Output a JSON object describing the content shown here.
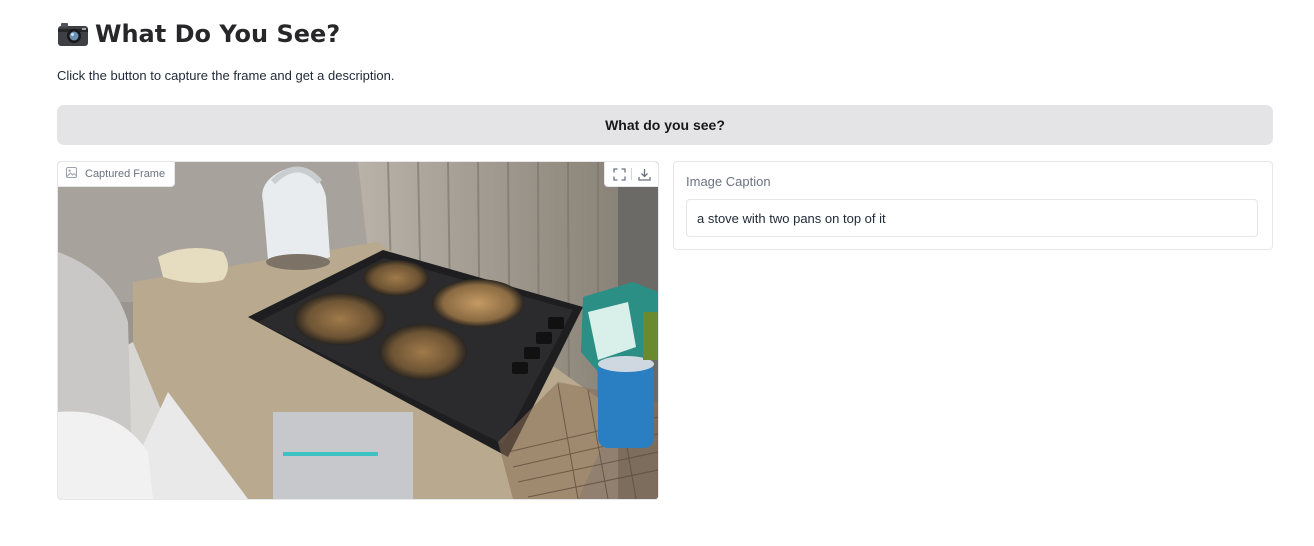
{
  "header": {
    "title": "What Do You See?",
    "title_icon": "camera-icon",
    "subtitle": "Click the button to capture the frame and get a description."
  },
  "action": {
    "button_label": "What do you see?"
  },
  "frame": {
    "label": "Captured Frame",
    "label_icon": "image-icon",
    "tools": [
      "fullscreen-icon",
      "download-icon"
    ]
  },
  "caption": {
    "label": "Image Caption",
    "value": "a stove with two pans on top of it"
  },
  "colors": {
    "button_bg": "#e4e4e7",
    "border": "#e5e7eb",
    "muted_text": "#6b7280"
  }
}
